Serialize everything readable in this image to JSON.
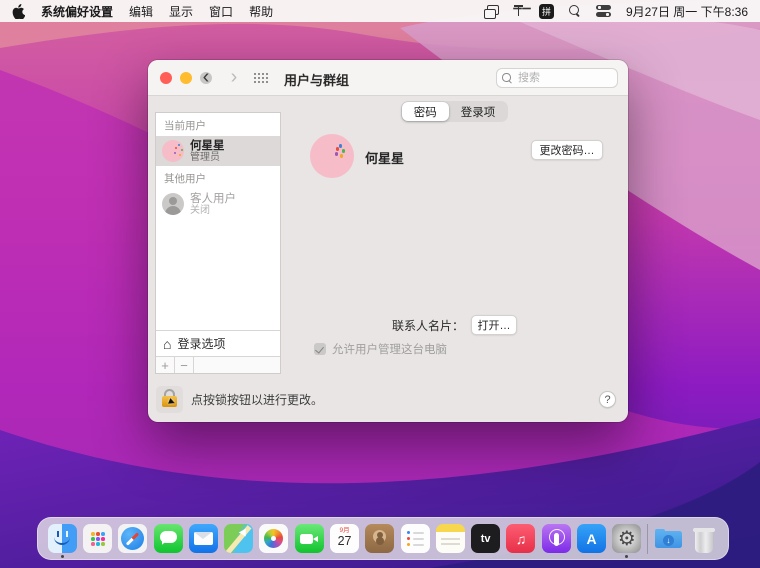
{
  "menu_bar": {
    "app_menu": "系统偏好设置",
    "menus": [
      "编辑",
      "显示",
      "窗口",
      "帮助"
    ],
    "input_badge": "拼",
    "clock": "9月27日 周一 下午8:36",
    "status_icons": [
      "screen-mirroring",
      "antenna",
      "pinyin-input",
      "spotlight",
      "control-center"
    ]
  },
  "window": {
    "title": "用户与群组",
    "search_placeholder": "搜索",
    "tabs": [
      {
        "label": "密码",
        "selected": true
      },
      {
        "label": "登录项",
        "selected": false
      }
    ],
    "sidebar": {
      "current_header": "当前用户",
      "current_user": {
        "name": "何星星",
        "role": "管理员",
        "avatar": "party-confetti",
        "selected": true
      },
      "other_header": "其他用户",
      "guest_user": {
        "name": "客人用户",
        "status": "关闭",
        "avatar": "guest-silhouette",
        "selected": false
      },
      "login_options": "登录选项",
      "add": "+",
      "remove": "−"
    },
    "main": {
      "user_name": "何星星",
      "change_password": "更改密码…",
      "contact_card_label": "联系人名片：",
      "open_button": "打开…",
      "admin_checkbox": "允许用户管理这台电脑",
      "admin_checked": true
    },
    "footer": {
      "lock_hint": "点按锁按钮以进行更改。",
      "help": "?"
    }
  },
  "dock": {
    "apps": [
      "finder",
      "launchpad",
      "safari",
      "messages",
      "mail",
      "maps",
      "photos",
      "facetime",
      "calendar",
      "contacts",
      "reminders",
      "notes",
      "tv",
      "music",
      "podcasts",
      "app-store",
      "system-preferences",
      "downloads",
      "trash"
    ],
    "running": [
      "finder",
      "system-preferences"
    ],
    "calendar": {
      "month": "9月",
      "day": "27"
    },
    "tv_label": "tv",
    "app_store_label": "A",
    "downloads_arrow": "↓"
  },
  "colors": {
    "traffic_red": "#ff5f57",
    "traffic_yellow": "#febc2e",
    "traffic_disabled": "#c9c7c6",
    "selection_gray": "#dcd9d8",
    "lock_gold": "#e3a82d",
    "window_bg": "#e8e5e4"
  }
}
